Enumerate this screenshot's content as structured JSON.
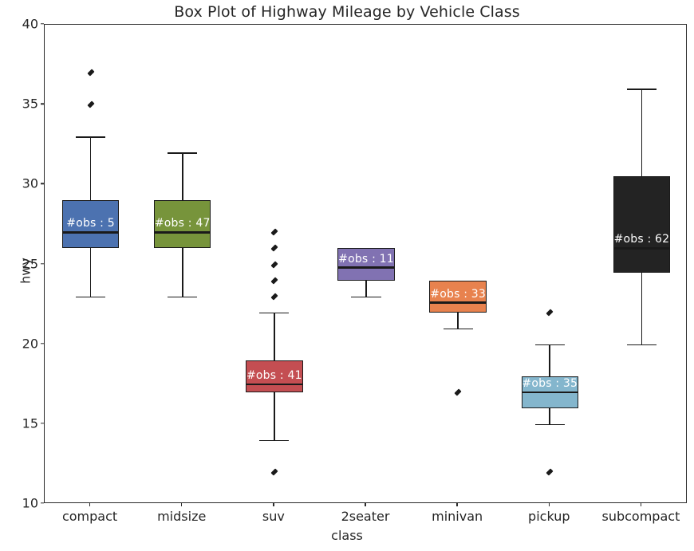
{
  "chart_data": {
    "type": "box",
    "title": "Box Plot of Highway Mileage by Vehicle Class",
    "xlabel": "class",
    "ylabel": "hwy",
    "ylim": [
      10,
      40
    ],
    "yticks": [
      10,
      15,
      20,
      25,
      30,
      35,
      40
    ],
    "grid": false,
    "legend": "none",
    "categories": [
      "compact",
      "midsize",
      "suv",
      "2seater",
      "minivan",
      "pickup",
      "subcompact"
    ],
    "boxes": [
      {
        "category": "compact",
        "color": "#4c72b0",
        "q1": 26,
        "median": 27,
        "q3": 29,
        "whisker_low": 23,
        "whisker_high": 33,
        "outliers": [
          35,
          37
        ],
        "n": 5,
        "annotation": "#obs : 5"
      },
      {
        "category": "midsize",
        "color": "#77943b",
        "q1": 26,
        "median": 27,
        "q3": 29,
        "whisker_low": 23,
        "whisker_high": 32,
        "outliers": [],
        "n": 47,
        "annotation": "#obs : 47"
      },
      {
        "category": "suv",
        "color": "#c44e52",
        "q1": 17,
        "median": 17.5,
        "q3": 19,
        "whisker_low": 14,
        "whisker_high": 22,
        "outliers": [
          12,
          23,
          24,
          25,
          26,
          27
        ],
        "n": 41,
        "annotation": "#obs : 41"
      },
      {
        "category": "2seater",
        "color": "#8172b2",
        "q1": 24,
        "median": 24.8,
        "q3": 26,
        "whisker_low": 23,
        "whisker_high": 26,
        "outliers": [],
        "n": 11,
        "annotation": "#obs : 11"
      },
      {
        "category": "minivan",
        "color": "#e8824e",
        "q1": 22,
        "median": 22.6,
        "q3": 24,
        "whisker_low": 21,
        "whisker_high": 24,
        "outliers": [
          17
        ],
        "n": 33,
        "annotation": "#obs : 33"
      },
      {
        "category": "pickup",
        "color": "#84b6cd",
        "q1": 16,
        "median": 17,
        "q3": 18,
        "whisker_low": 15,
        "whisker_high": 20,
        "outliers": [
          12,
          22
        ],
        "n": 35,
        "annotation": "#obs : 35"
      },
      {
        "category": "subcompact",
        "color": "#232323",
        "q1": 24.5,
        "median": 26,
        "q3": 30.5,
        "whisker_low": 20,
        "whisker_high": 36,
        "outliers": [],
        "n": 62,
        "annotation": "#obs : 62"
      }
    ]
  },
  "axes": {
    "spine_color": "#2b2b2b",
    "background": "#ffffff"
  }
}
